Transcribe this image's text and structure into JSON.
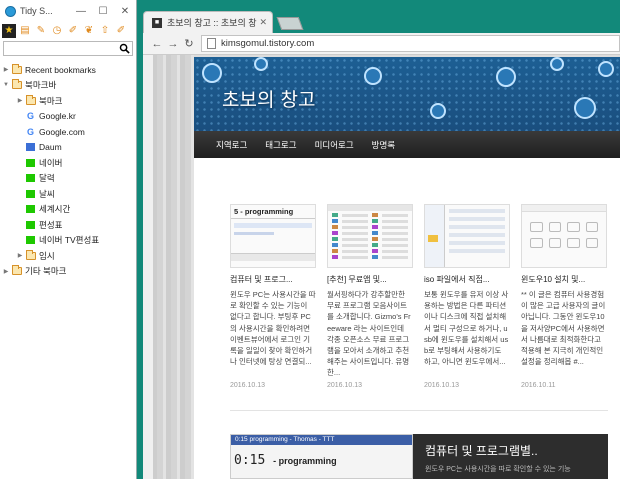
{
  "sidebar": {
    "title": "Tidy S...",
    "window_buttons": {
      "minimize": "—",
      "maximize": "☐",
      "close": "✕"
    },
    "search": {
      "value": "",
      "placeholder": ""
    },
    "tree": [
      {
        "label": "Recent bookmarks",
        "icon": "folder-icon",
        "level": 0,
        "arrow": "▶"
      },
      {
        "label": "북마크바",
        "icon": "folder-icon",
        "level": 0,
        "arrow": "▼"
      },
      {
        "label": "북마크",
        "icon": "folder-icon",
        "level": 1,
        "arrow": "▶"
      },
      {
        "label": "Google.kr",
        "icon": "google-icon",
        "level": 1,
        "arrow": ""
      },
      {
        "label": "Google.com",
        "icon": "google-icon",
        "level": 1,
        "arrow": ""
      },
      {
        "label": "Daum",
        "icon": "daum-icon",
        "level": 1,
        "arrow": ""
      },
      {
        "label": "네이버",
        "icon": "naver-icon",
        "level": 1,
        "arrow": ""
      },
      {
        "label": "달력",
        "icon": "naver-icon",
        "level": 1,
        "arrow": ""
      },
      {
        "label": "날씨",
        "icon": "naver-icon",
        "level": 1,
        "arrow": ""
      },
      {
        "label": "세계시간",
        "icon": "naver-icon",
        "level": 1,
        "arrow": ""
      },
      {
        "label": "편성표",
        "icon": "naver-icon",
        "level": 1,
        "arrow": ""
      },
      {
        "label": "네이버 TV편성표",
        "icon": "naver-icon",
        "level": 1,
        "arrow": ""
      },
      {
        "label": "임시",
        "icon": "folder-icon",
        "level": 1,
        "arrow": "▶"
      },
      {
        "label": "기타 북마크",
        "icon": "folder-icon",
        "level": 0,
        "arrow": "▶"
      }
    ]
  },
  "browser": {
    "tab_title": "초보의 창고 :: 초보의 창",
    "tab_close": "✕",
    "url": "kimsgomul.tistory.com"
  },
  "site": {
    "title": "초보의 창고",
    "menu": [
      "지역로그",
      "태그로그",
      "미디어로그",
      "방명록"
    ],
    "posts": [
      {
        "title": "컴퓨터 및 프로그...",
        "excerpt": "윈도우 PC는 사용시간을 따로 확인할 수 있는 기능이 없다고 합니다. 부팅후 PC의 사용시간을 확인하려면 이벤트뷰어에서 로그인 기록을 일일이 찾아 확인하거나 인터넷에 탕상 연결되...",
        "date": "2016.10.13"
      },
      {
        "title": "[추천] 무료앱 및...",
        "excerpt": "월서핑하다가 강추할만한 무료 프로그램 모음사이트를 소개합니다. Gizmo's Freeware 라는 사이트인데 각종 오픈소스 무료 프로그램을 모아서 소개하고 추천해주는 사이트입니다. 유명한...",
        "date": "2016.10.13"
      },
      {
        "title": "iso 파일에서 직접...",
        "excerpt": "보통 윈도우를 유저 이상 사용하는 방법은 다른 파티션이나 디스크에 직접 설치해서 멀티 구성으로 하거나, usb에 윈도우를 설치해서 usb로 부팅해서 사용하기도 하고, 아니면 윈도우에서...",
        "date": "2016.10.13"
      },
      {
        "title": "윈도우10 설치 및...",
        "excerpt": "** 이 글은 컴퓨터 사용경험이 많은 고급 사용자의 글이 아닙니다. 그동안 윈도우10을 저사양PC에서 사용하면서 나름대로 최적화한다고 적용해 본 지극히 개인적인 설정을 정리해봅 #...",
        "date": "2016.10.11"
      }
    ],
    "thumb1_heading": "5  - programming",
    "feature": {
      "thumb_bar": "0:15 programming - Thomas - TTT",
      "thumb_time": "0:15",
      "thumb_label": "- programming",
      "title": "컴퓨터 및 프로그램별..",
      "excerpt": "윈도우 PC는 사용시간을 따로 확인할 수 있는 기능"
    }
  }
}
